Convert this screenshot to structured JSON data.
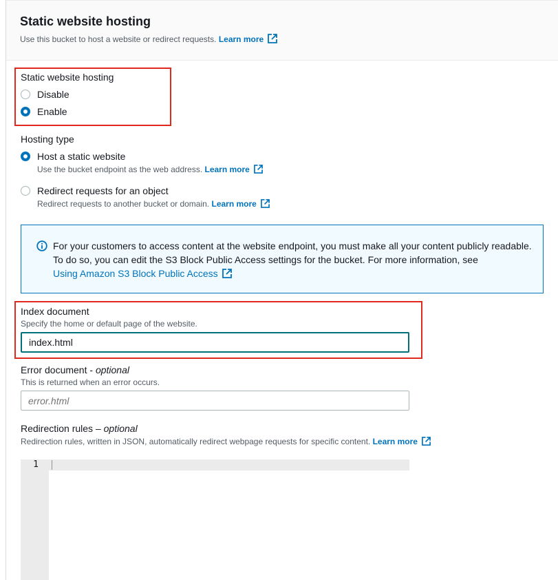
{
  "header": {
    "title": "Static website hosting",
    "description": "Use this bucket to host a website or redirect requests.",
    "learn_more": "Learn more"
  },
  "hosting_toggle": {
    "label": "Static website hosting",
    "options": [
      {
        "label": "Disable",
        "selected": false
      },
      {
        "label": "Enable",
        "selected": true
      }
    ]
  },
  "hosting_type": {
    "label": "Hosting type",
    "options": [
      {
        "label": "Host a static website",
        "description": "Use the bucket endpoint as the web address.",
        "learn_more": "Learn more",
        "selected": true
      },
      {
        "label": "Redirect requests for an object",
        "description": "Redirect requests to another bucket or domain.",
        "learn_more": "Learn more",
        "selected": false
      }
    ]
  },
  "info_alert": {
    "text": "For your customers to access content at the website endpoint, you must make all your content publicly readable. To do so, you can edit the S3 Block Public Access settings for the bucket. For more information, see",
    "link": "Using Amazon S3 Block Public Access"
  },
  "index_document": {
    "label": "Index document",
    "description": "Specify the home or default page of the website.",
    "value": "index.html"
  },
  "error_document": {
    "label": "Error document",
    "optional": "optional",
    "separator": " - ",
    "description": "This is returned when an error occurs.",
    "placeholder": "error.html"
  },
  "redirection_rules": {
    "label": "Redirection rules",
    "separator": " – ",
    "optional": "optional",
    "description": "Redirection rules, written in JSON, automatically redirect webpage requests for specific content.",
    "learn_more": "Learn more",
    "line_number": "1"
  },
  "colors": {
    "accent": "#0073bb",
    "highlight": "#e0281f",
    "focus": "#00707a"
  }
}
